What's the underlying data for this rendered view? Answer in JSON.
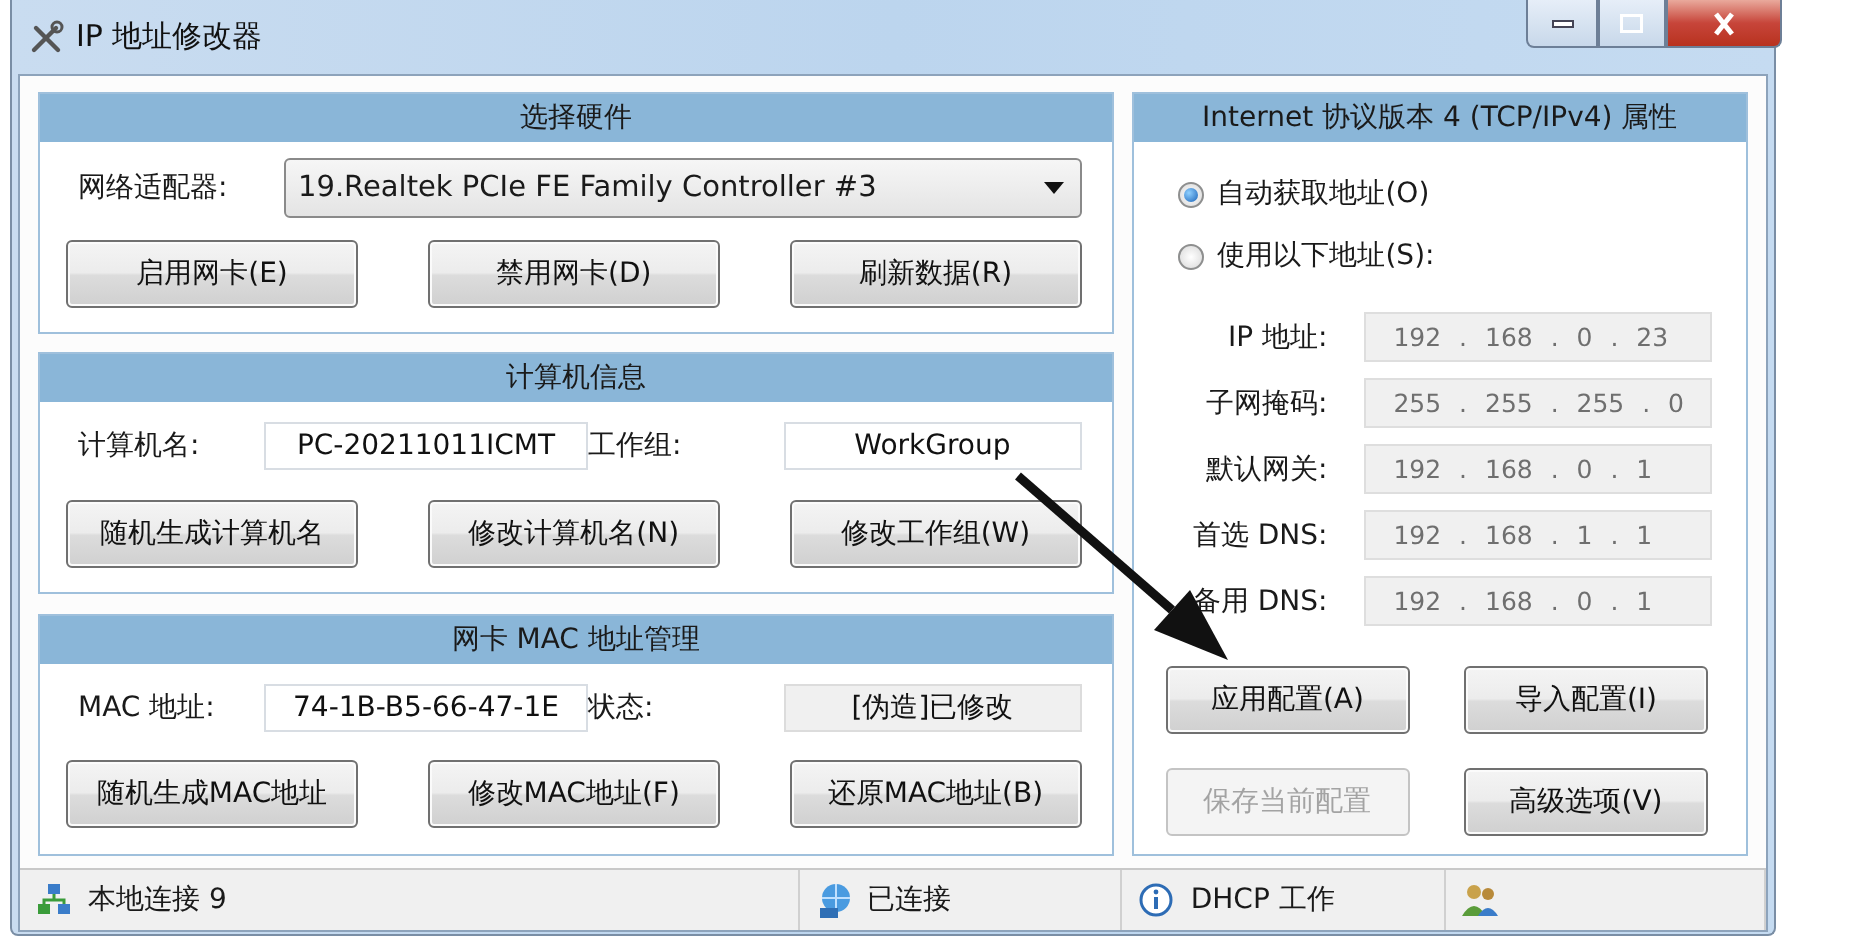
{
  "window": {
    "title": "IP 地址修改器"
  },
  "hardware": {
    "title": "选择硬件",
    "adapter_label": "网络适配器:",
    "adapter": "19.Realtek PCIe FE Family Controller #3",
    "buttons": [
      {
        "label": "启用网卡(E)",
        "disabled": false
      },
      {
        "label": "禁用网卡(D)",
        "disabled": false
      },
      {
        "label": "刷新数据(R)",
        "disabled": false
      }
    ]
  },
  "computer": {
    "title": "计算机信息",
    "fields": [
      {
        "label": "计算机名:",
        "value": "PC-20211011ICMT",
        "readonly": false
      },
      {
        "label": "工作组:",
        "value": "WorkGroup",
        "readonly": false
      }
    ],
    "buttons": [
      {
        "label": "随机生成计算机名",
        "disabled": false
      },
      {
        "label": "修改计算机名(N)",
        "disabled": false
      },
      {
        "label": "修改工作组(W)",
        "disabled": false
      }
    ]
  },
  "mac": {
    "title": "网卡 MAC 地址管理",
    "fields": [
      {
        "label": "MAC 地址:",
        "value": "74-1B-B5-66-47-1E",
        "readonly": false
      },
      {
        "label": "状态:",
        "value": "[伪造]已修改",
        "readonly": true
      }
    ],
    "buttons": [
      {
        "label": "随机生成MAC地址",
        "disabled": false
      },
      {
        "label": "修改MAC地址(F)",
        "disabled": false
      },
      {
        "label": "还原MAC地址(B)",
        "disabled": false
      }
    ]
  },
  "ipv4": {
    "title": "Internet 协议版本 4 (TCP/IPv4) 属性",
    "modes": [
      {
        "label": "自动获取地址(O)",
        "selected": true
      },
      {
        "label": "使用以下地址(S):",
        "selected": false
      }
    ],
    "addresses": [
      {
        "label": "IP 地址:",
        "value": "192 . 168 . 0 . 23",
        "disabled": true
      },
      {
        "label": "子网掩码:",
        "value": "255 . 255 . 255 . 0",
        "disabled": true
      },
      {
        "label": "默认网关:",
        "value": "192 . 168 . 0 . 1",
        "disabled": true
      },
      {
        "label": "首选 DNS:",
        "value": "192 . 168 . 1 . 1",
        "disabled": true
      },
      {
        "label": "备用 DNS:",
        "value": "192 . 168 . 0 . 1",
        "disabled": true
      }
    ],
    "buttons": [
      {
        "label": "应用配置(A)",
        "disabled": false
      },
      {
        "label": "导入配置(I)",
        "disabled": false
      },
      {
        "label": "保存当前配置",
        "disabled": true
      },
      {
        "label": "高级选项(V)",
        "disabled": false
      }
    ]
  },
  "status_bar": [
    {
      "kind": "network",
      "text": "本地连接 9"
    },
    {
      "kind": "globe",
      "text": "已连接"
    },
    {
      "kind": "info",
      "text": "DHCP 工作"
    },
    {
      "kind": "users"
    }
  ]
}
